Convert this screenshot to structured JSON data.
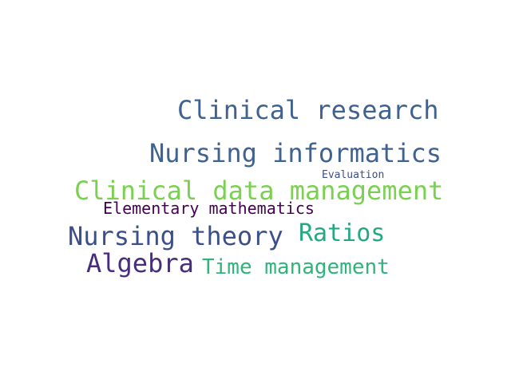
{
  "words": [
    {
      "text": "Clinical research",
      "color": "#3f6291"
    },
    {
      "text": "Nursing informatics",
      "color": "#3f6291"
    },
    {
      "text": "Evaluation",
      "color": "#3b4f8a"
    },
    {
      "text": "Clinical data management",
      "color": "#7ad151"
    },
    {
      "text": "Elementary mathematics",
      "color": "#440154"
    },
    {
      "text": "Nursing theory",
      "color": "#3b4f8a"
    },
    {
      "text": "Ratios",
      "color": "#26a784"
    },
    {
      "text": "Algebra",
      "color": "#472d7b"
    },
    {
      "text": "Time management",
      "color": "#2fb47c"
    }
  ]
}
